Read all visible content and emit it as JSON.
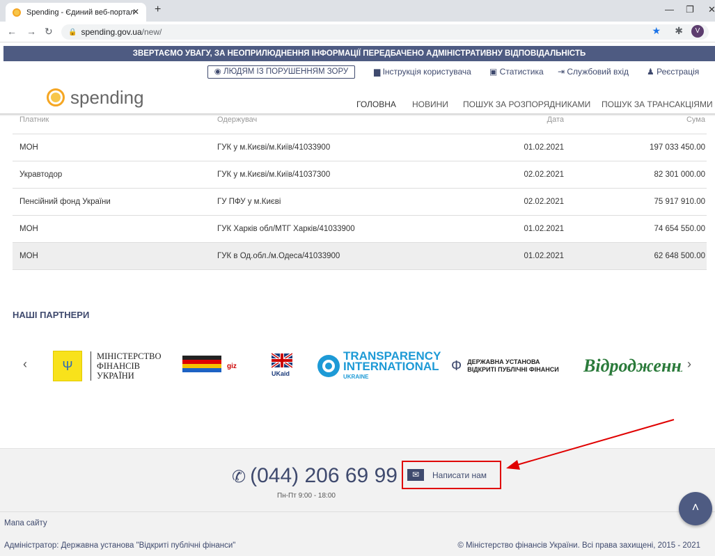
{
  "browser": {
    "tab_title": "Spending - Єдиний веб-портал",
    "tab_close": "✕",
    "new_tab": "+",
    "url_host": "spending.gov.ua",
    "url_path": "/new/",
    "profile_initial": "V"
  },
  "notice": "ЗВЕРТАЄМО УВАГУ, ЗА НЕОПРИЛЮДНЕННЯ ІНФОРМАЦІЇ ПЕРЕДБАЧЕНО АДМІНІСТРАТИВНУ ВІДПОВІДАЛЬНІСТЬ",
  "top_links": {
    "vision": "ЛЮДЯМ ІЗ ПОРУШЕННЯМ ЗОРУ",
    "manual": "Інструкція користувача",
    "stats": "Статистика",
    "service_login": "Службовий вхід",
    "register": "Реєстрація"
  },
  "logo_text": "spending",
  "main_nav": {
    "home": "ГОЛОВНА",
    "news": "НОВИНИ",
    "search_managers": "ПОШУК ЗА РОЗПОРЯДНИКАМИ",
    "search_transactions": "ПОШУК ЗА ТРАНСАКЦІЯМИ"
  },
  "table": {
    "headers": [
      "Платник",
      "Одержувач",
      "Дата",
      "Сума"
    ],
    "rows": [
      [
        "МОН",
        "ГУК у м.Києві/м.Київ/41033900",
        "01.02.2021",
        "197 033 450.00"
      ],
      [
        "Укравтодор",
        "ГУК у м.Києві/м.Київ/41037300",
        "02.02.2021",
        "82 301 000.00"
      ],
      [
        "Пенсійний фонд України",
        "ГУ ПФУ у м.Києві",
        "02.02.2021",
        "75 917 910.00"
      ],
      [
        "МОН",
        "ГУК Харків обл/МТГ Харків/41033900",
        "01.02.2021",
        "74 654 550.00"
      ],
      [
        "МОН",
        "ГУК в Од.обл./м.Одеса/41033900",
        "01.02.2021",
        "62 648 500.00"
      ]
    ]
  },
  "partners": {
    "title": "НАШІ ПАРТНЕРИ",
    "minfin": [
      "МІНІСТЕРСТВО",
      "ФІНАНСІВ",
      "УКРАЇНИ"
    ],
    "giz": "giz",
    "ukaid": "UKaid",
    "ti": [
      "TRANSPARENCY",
      "INTERNATIONAL",
      "UKRAINE"
    ],
    "dups": [
      "ДЕРЖАВНА УСТАНОВА",
      "ВІДКРИТІ ПУБЛІЧНІ ФІНАНСИ"
    ],
    "vid": "Відродження"
  },
  "footer": {
    "phone": "(044) 206 69 99",
    "hours": "Пн-Пт 9:00 - 18:00",
    "write_us": "Написати нам",
    "sitemap": "Мапа сайту",
    "admin": "Адміністратор: Державна установа \"Відкриті публічні фінанси\"",
    "copyright": "© Міністерство фінансів України. Всі права захищені, 2015 - 2021"
  },
  "colors": {
    "accent": "#f5a623",
    "navy": "#4e5b82",
    "annotation": "#e00000"
  }
}
